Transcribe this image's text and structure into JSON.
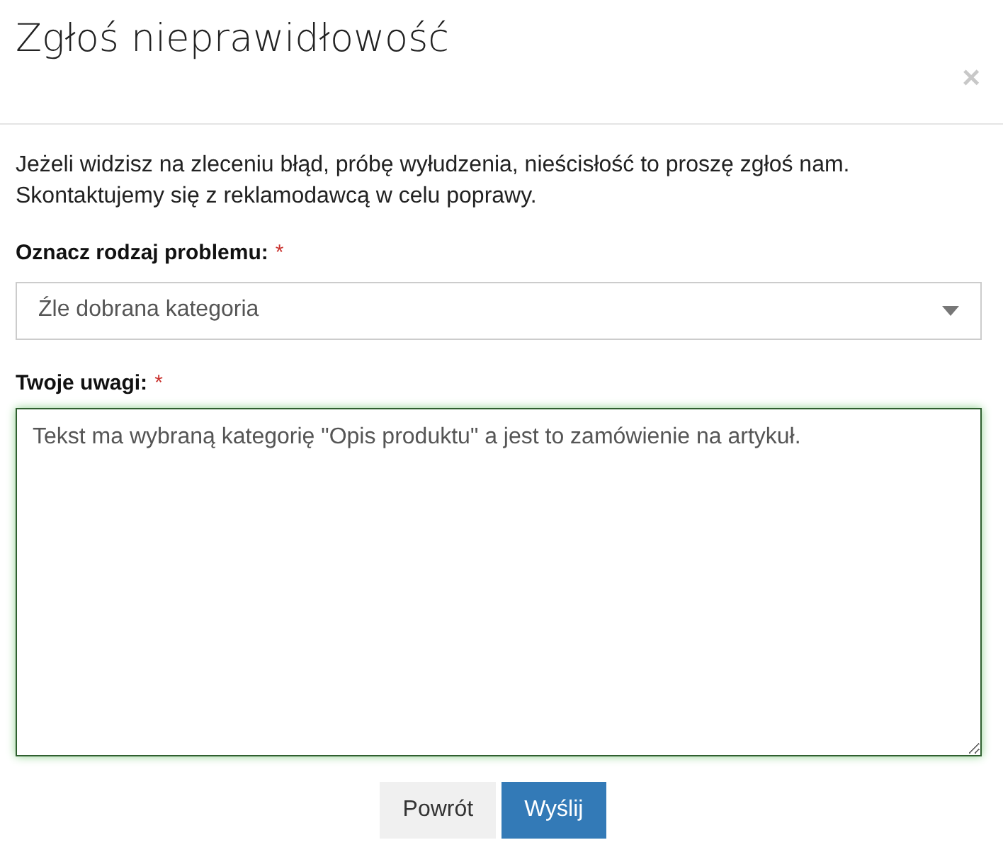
{
  "dialog": {
    "title": "Zgłoś nieprawidłowość",
    "close": "×"
  },
  "intro": "Jeżeli widzisz na zleceniu błąd, próbę wyłudzenia, nieścisłość to proszę zgłoś nam. Skontaktujemy się z reklamodawcą w celu poprawy.",
  "problem_type": {
    "label": "Oznacz rodzaj problemu:",
    "required_mark": "*",
    "value": "Źle dobrana kategoria"
  },
  "remarks": {
    "label": "Twoje uwagi:",
    "required_mark": "*",
    "value": "Tekst ma wybraną kategorię \"Opis produktu\" a jest to zamówienie na artykuł.",
    "focused": true
  },
  "buttons": [
    {
      "label": "Powrót",
      "kind": "secondary"
    },
    {
      "label": "Wyślij",
      "kind": "primary"
    }
  ]
}
